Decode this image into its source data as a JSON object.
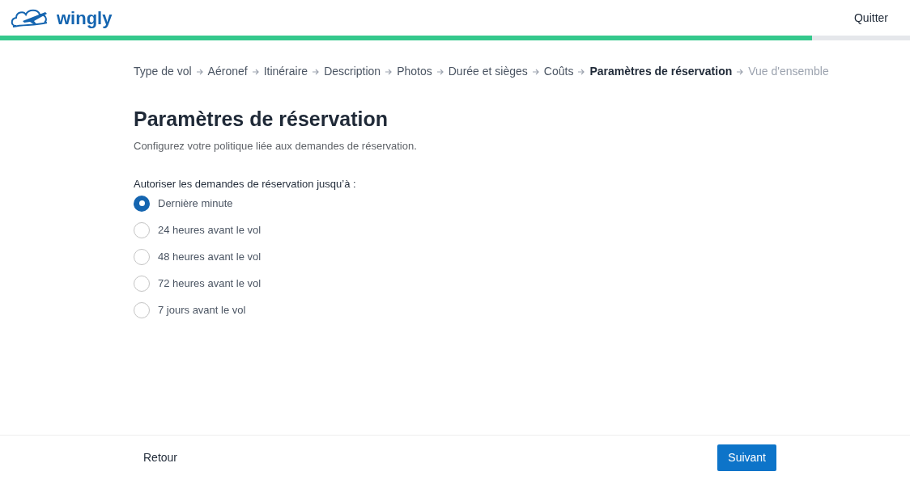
{
  "header": {
    "logo_text": "wingly",
    "quit": "Quitter"
  },
  "progress": {
    "level": 0.892
  },
  "breadcrumb": [
    {
      "label": "Type de vol",
      "kind": "done"
    },
    {
      "label": "Aéronef",
      "kind": "done"
    },
    {
      "label": "Itinéraire",
      "kind": "done"
    },
    {
      "label": "Description",
      "kind": "done"
    },
    {
      "label": "Photos",
      "kind": "done"
    },
    {
      "label": "Durée et sièges",
      "kind": "done"
    },
    {
      "label": "Coûts",
      "kind": "done"
    },
    {
      "label": "Paramètres de réservation",
      "kind": "current"
    },
    {
      "label": "Vue d'ensemble",
      "kind": "upcoming"
    }
  ],
  "title": "Paramètres de réservation",
  "subtitle": "Configurez votre politique liée aux demandes de réservation.",
  "question": "Autoriser les demandes de réservation jusqu’à :",
  "options": [
    {
      "label": "Dernière minute",
      "selected": true
    },
    {
      "label": "24 heures avant le vol",
      "selected": false
    },
    {
      "label": "48 heures avant le vol",
      "selected": false
    },
    {
      "label": "72 heures avant le vol",
      "selected": false
    },
    {
      "label": "7 jours avant le vol",
      "selected": false
    }
  ],
  "footer": {
    "back": "Retour",
    "next": "Suivant"
  }
}
